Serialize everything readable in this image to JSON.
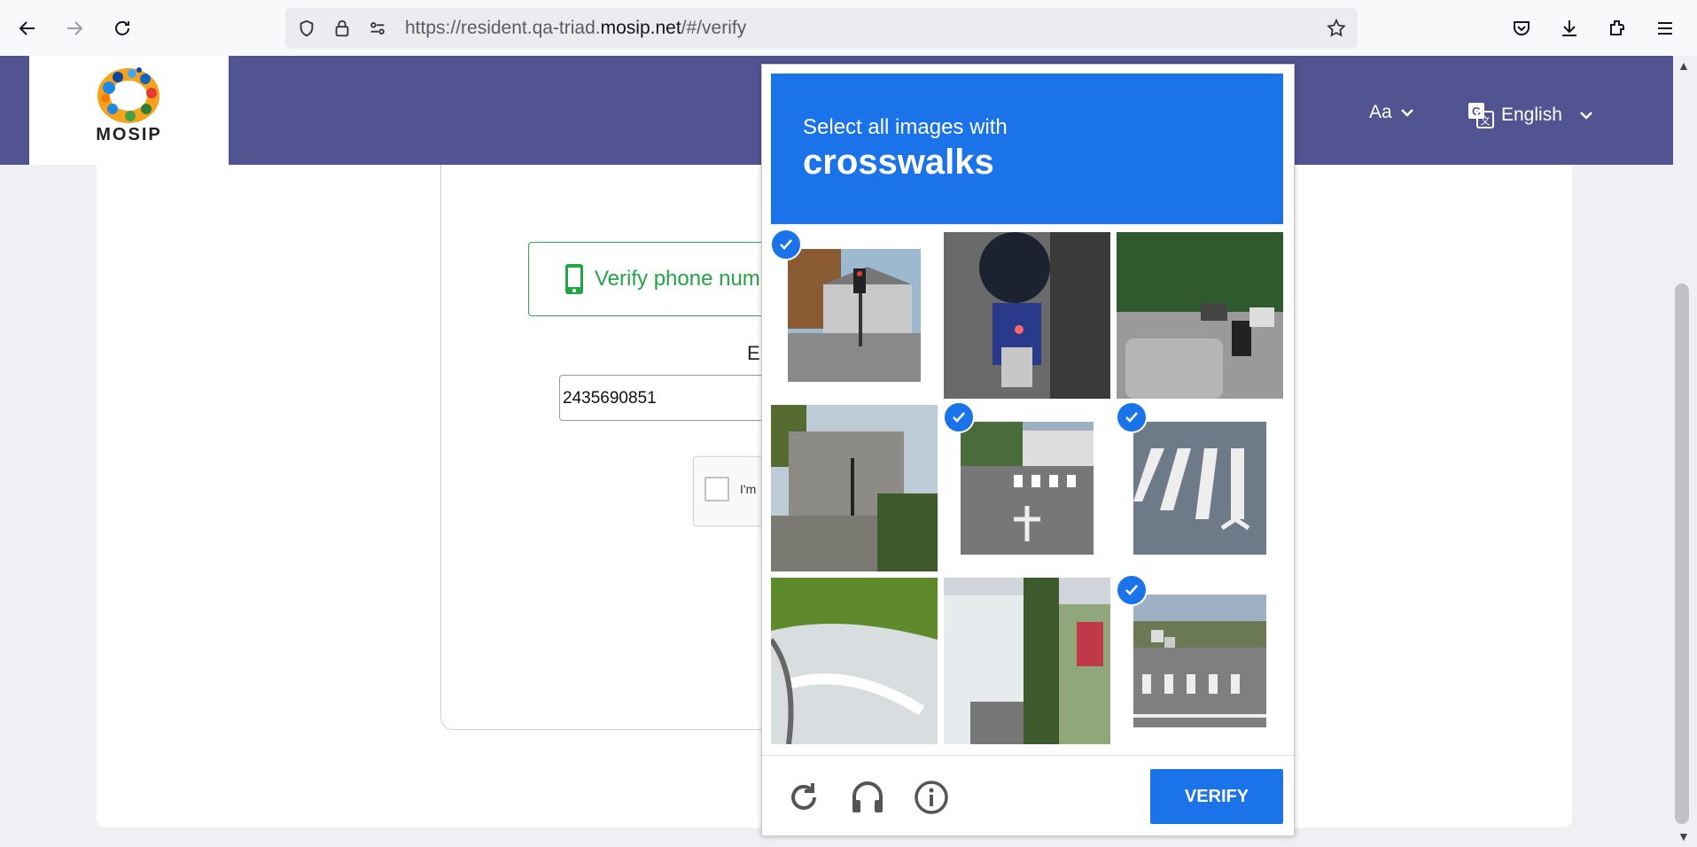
{
  "browser": {
    "url_prefix": "https://resident.qa-triad.",
    "url_domain": "mosip.net",
    "url_suffix": "/#/verify"
  },
  "header": {
    "logo_text": "MOSIP",
    "font_size_label": "Aa",
    "language": "English"
  },
  "page": {
    "verify_tab_label": "Verify phone num",
    "field_label_partial": "E",
    "phone_value": "2435690851",
    "recaptcha_label": "I'm"
  },
  "captcha": {
    "instruction": "Select all images with",
    "target": "crosswalks",
    "verify_label": "VERIFY",
    "tiles": [
      {
        "scene": "traffic-light-house",
        "selected": true
      },
      {
        "scene": "motorcycle",
        "selected": false
      },
      {
        "scene": "street-cars",
        "selected": false
      },
      {
        "scene": "building-traffic-light",
        "selected": false
      },
      {
        "scene": "crosswalk-corner",
        "selected": true
      },
      {
        "scene": "crosswalk-closeup",
        "selected": true
      },
      {
        "scene": "river-stream",
        "selected": false
      },
      {
        "scene": "house-wall",
        "selected": false
      },
      {
        "scene": "crosswalk-road",
        "selected": true
      }
    ]
  },
  "colors": {
    "header": "#515491",
    "captcha_blue": "#1a73e8",
    "verify_green": "#22a447"
  }
}
